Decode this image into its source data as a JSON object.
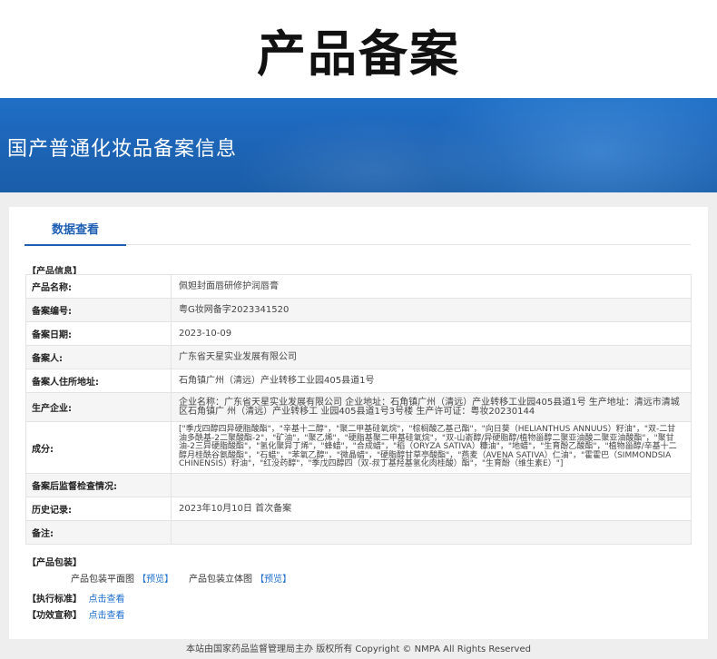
{
  "header": {
    "title": "产品备案"
  },
  "banner": {
    "title": "国产普通化妆品备案信息"
  },
  "tabs": [
    {
      "label": "数据查看"
    }
  ],
  "product_info": {
    "section_label": "【产品信息】",
    "rows": [
      {
        "key": "产品名称:",
        "value": "佩妲封面唇研修护润唇膏"
      },
      {
        "key": "备案编号:",
        "value": "粤G妆网备字2023341520"
      },
      {
        "key": "备案日期:",
        "value": "2023-10-09"
      },
      {
        "key": "备案人:",
        "value": "广东省天星实业发展有限公司"
      },
      {
        "key": "备案人住所地址:",
        "value": "石角镇广州（清远）产业转移工业园405县道1号"
      },
      {
        "key": "生产企业:",
        "value": "企业名称：广东省天星实业发展有限公司 企业地址：石角镇广州（清远）产业转移工业园405县道1号 生产地址：清远市清城区石角镇广 州（清远）产业转移工 业园405县道1号3号楼 生产许可证：粤妆20230144"
      },
      {
        "key": "成分:",
        "value": "[\"季戊四醇四异硬脂酸酯\"，\"辛基十二醇\"，\"聚二甲基硅氧烷\"，\"棕榈酸乙基己酯\"，\"向日葵（HELIANTHUS ANNUUS）籽油\"，\"双-二甘油多酰基-2二聚酸酯-2\"，\"矿油\"，\"聚乙烯\"，\"硬脂基聚二甲基硅氧烷\"，\"双-山嵛醇/异硬脂醇/植物甾醇二聚亚油酸二聚亚油酸酯\"，\"聚甘油-2三异硬脂酸酯\"，\"氢化聚异丁烯\"，\"蜂蜡\"，\"合成蜡\"，\"稻（ORYZA SATIVA）糠油\"，\"地蜡\"，\"生育酚乙酸酯\"，\"植物甾醇/辛基十二醇月桂酰谷氨酸酯\"，\"石蜡\"，\"苯氧乙醇\"，\"微晶蜡\"，\"硬脂醇甘草亭酸酯\"，\"燕麦（AVENA SATIVA）仁油\"，\"霍霍巴（SIMMONDSIA CHINENSIS）籽油\"，\"红没药醇\"，\"季戊四醇四（双-叔丁基羟基氢化肉桂酸）酯\"，\"生育酚（维生素E）\"]"
      },
      {
        "key": "备案后监督检查情况:",
        "value": ""
      },
      {
        "key": "历史记录:",
        "value": "2023年10月10日 首次备案"
      },
      {
        "key": "备注:",
        "value": ""
      }
    ]
  },
  "packaging": {
    "section_label": "【产品包装】",
    "flat_label": "产品包装平面图",
    "flat_link": "【预览】",
    "solid_label": "产品包装立体图",
    "solid_link": "【预览】"
  },
  "standard": {
    "label": "【执行标准】",
    "link": "点击查看"
  },
  "efficacy": {
    "label": "【功效宣称】",
    "link": "点击查看"
  },
  "footer": {
    "text": "本站由国家药品监督管理局主办 版权所有 Copyright © NMPA All Rights Reserved"
  }
}
